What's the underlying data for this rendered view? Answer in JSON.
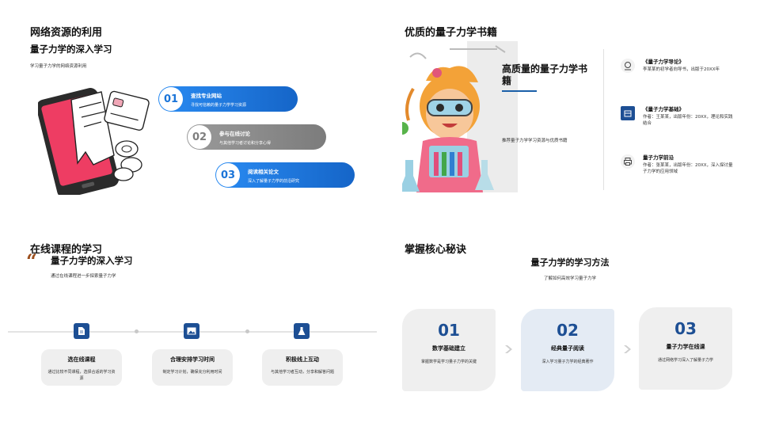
{
  "slide1": {
    "title": "网络资源的利用",
    "subtitle": "量子力学的深入学习",
    "description": "学习量子力学的网络资源利用",
    "steps": [
      {
        "num": "01",
        "title": "查找专业网站",
        "desc": "寻找可信赖的量子力学学习资源"
      },
      {
        "num": "02",
        "title": "参与在线讨论",
        "desc": "与其他学习者讨论和分享心得"
      },
      {
        "num": "03",
        "title": "阅读相关论文",
        "desc": "深入了解量子力学的前沿研究"
      }
    ]
  },
  "slide2": {
    "title": "优质的量子力学书籍",
    "headline": "高质量的量子力学书籍",
    "headline_desc": "推荐量子力学学习资源与优质书籍",
    "books": [
      {
        "icon": "hand-coin-icon",
        "title": "《量子力学导论》",
        "desc": "李某某的初学者向导书，出版于20XX年"
      },
      {
        "icon": "box-icon",
        "title": "《量子力学基础》",
        "desc": "作者：王某某，出版年份：20XX，理论和实践结合"
      },
      {
        "icon": "printer-icon",
        "title": "量子力学前沿",
        "desc": "作者：张某某，出版年份：20XX，深入探讨量子力学的应用领域"
      }
    ]
  },
  "slide3": {
    "title": "在线课程的学习",
    "quote_mark": "“",
    "subtitle": "量子力学的深入学习",
    "description": "通过在线课程进一步探索量子力学",
    "cards": [
      {
        "icon": "document-icon",
        "title": "选在线课程",
        "desc": "通过比较不同课程，选择合适的学习资源"
      },
      {
        "icon": "image-icon",
        "title": "合理安排学习时间",
        "desc": "制定学习计划，确保充分利用时间"
      },
      {
        "icon": "flask-icon",
        "title": "积极线上互动",
        "desc": "与其他学习者互动，分享和解答问题"
      }
    ]
  },
  "slide4": {
    "title": "掌握核心秘诀",
    "subtitle": "量子力学的学习方法",
    "description": "了解如何高效学习量子力学",
    "cards": [
      {
        "num": "01",
        "title": "数学基础建立",
        "desc": "掌握数学是学习量子力学的关键"
      },
      {
        "num": "02",
        "title": "经典量子阅读",
        "desc": "深入学习量子力学的经典著作"
      },
      {
        "num": "03",
        "title": "量子力学在线课",
        "desc": "通过网络学习深入了解量子力学"
      }
    ]
  },
  "colors": {
    "accent_blue": "#1d4f94",
    "pill_blue": "#1a74d8",
    "pill_grey": "#8a8a8a",
    "quote_brown": "#9c4f1d"
  }
}
